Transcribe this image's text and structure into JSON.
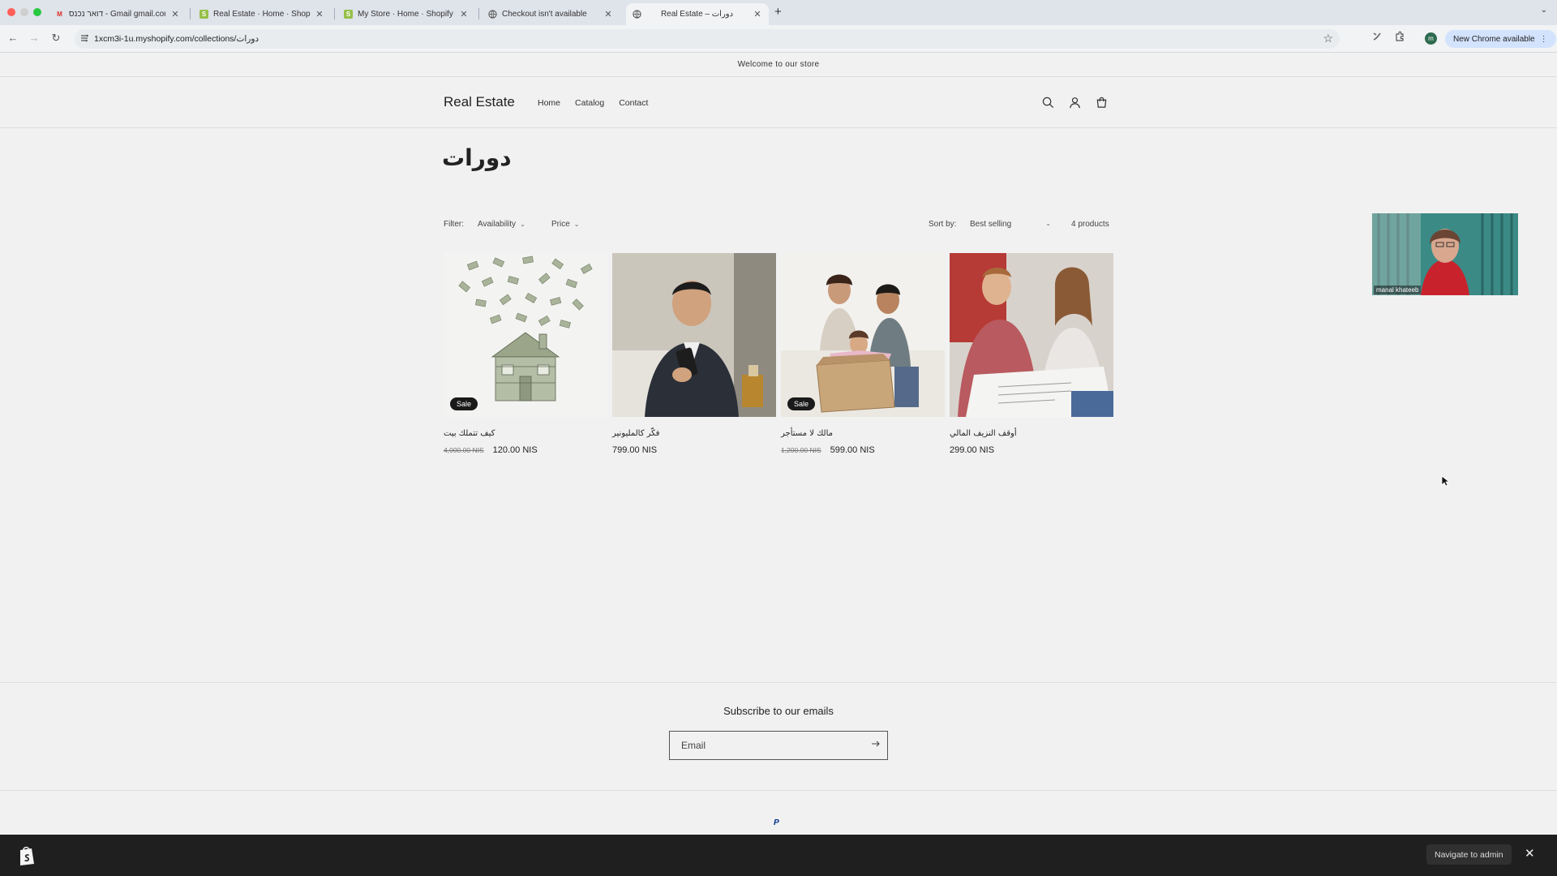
{
  "browser": {
    "tabs": [
      {
        "title": "דואר נכנס - Gmail ‏gmail.com",
        "favicon": "M",
        "active": false
      },
      {
        "title": "Real Estate · Home · Shopify",
        "favicon": "S",
        "active": false
      },
      {
        "title": "My Store · Home · Shopify",
        "favicon": "S",
        "active": false
      },
      {
        "title": "Checkout isn't available",
        "favicon": "globe",
        "active": false
      },
      {
        "title": "Real Estate – دورات",
        "favicon": "globe",
        "active": true
      }
    ],
    "url": "1xcm3i-1u.myshopify.com/collections/دورات",
    "profile_initial": "m",
    "chrome_pill": "New Chrome available"
  },
  "store": {
    "announcement": "Welcome to our store",
    "logo": "Real Estate",
    "nav": [
      "Home",
      "Catalog",
      "Contact"
    ],
    "collection_title": "دورات",
    "filter_label": "Filter:",
    "filter_availability": "Availability",
    "filter_price": "Price",
    "sort_label": "Sort by:",
    "sort_value": "Best selling",
    "product_count": "4 products",
    "products": [
      {
        "title": "كيف تتملك بيت",
        "old_price": "4,000.00 NIS",
        "price": "120.00 NIS",
        "badge": "Sale"
      },
      {
        "title": "فكّر كالمليونير",
        "old_price": "",
        "price": "799.00 NIS",
        "badge": ""
      },
      {
        "title": "مالك لا مستأجر",
        "old_price": "1,200.00 NIS",
        "price": "599.00 NIS",
        "badge": "Sale"
      },
      {
        "title": "أوقف النزيف المالي",
        "old_price": "",
        "price": "299.00 NIS",
        "badge": ""
      }
    ],
    "subscribe_title": "Subscribe to our emails",
    "email_placeholder": "Email",
    "payment_icon": "P"
  },
  "admin_bar": {
    "navigate_label": "Navigate to admin",
    "close_glyph": "✕"
  },
  "video": {
    "participant_name": "manal khateeb"
  },
  "colors": {
    "page_bg": "#f1f1f1",
    "admin_bar_bg": "#1f1f1f",
    "sale_badge": "#1a1a1a",
    "chrome_pill": "#d3e3fd"
  }
}
